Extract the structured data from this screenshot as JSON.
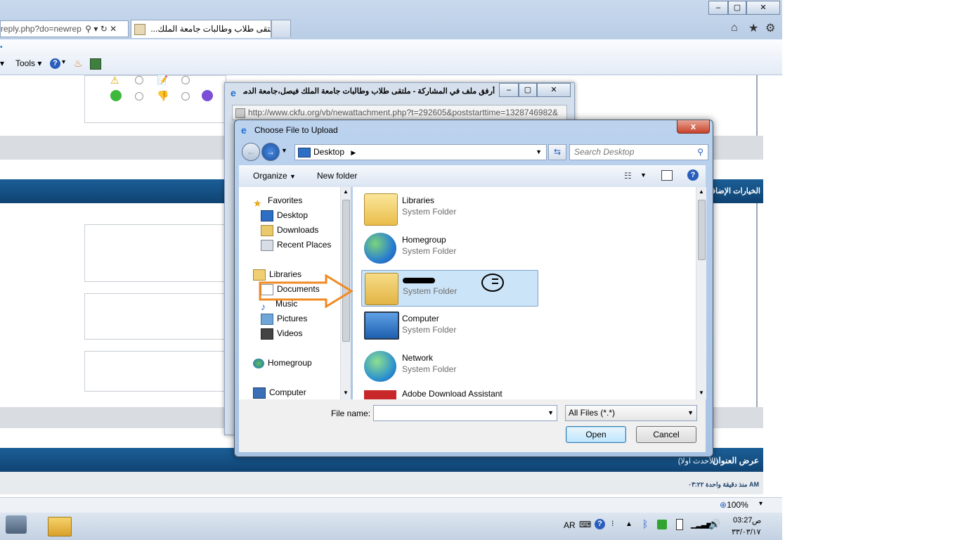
{
  "browser": {
    "address_text": "reply.php?do=newrep",
    "tab_title": "...ملتقى طلاب وطالبات جامعة الملك",
    "tab_close": "×",
    "command_tools": "Tools",
    "zoom": "100%"
  },
  "page": {
    "options_header": "الخيارات الإضافية",
    "view_title_label": "عرض العنوان",
    "view_title_note": "(الأحدث اولا)",
    "time_text": "منذ دقيقة واحدة ٠٣:٢٢ AM"
  },
  "popup": {
    "title": "أرفق ملف في المشاركة - ملتقى طلاب وطالبات جامعة الملك فيصل،جامعة الدمام - Win...",
    "url": "http://www.ckfu.org/vb/newattachment.php?t=292605&poststarttime=1328746982&"
  },
  "dialog": {
    "title": "Choose File to Upload",
    "close_label": "x",
    "breadcrumb": "Desktop",
    "search_placeholder": "Search Desktop",
    "toolbar": {
      "organize": "Organize",
      "new_folder": "New folder"
    },
    "nav": {
      "favorites": "Favorites",
      "desktop": "Desktop",
      "downloads": "Downloads",
      "recent": "Recent Places",
      "libraries": "Libraries",
      "documents": "Documents",
      "music": "Music",
      "pictures": "Pictures",
      "videos": "Videos",
      "homegroup": "Homegroup",
      "computer": "Computer"
    },
    "items": [
      {
        "name": "Libraries",
        "type": "System Folder"
      },
      {
        "name": "Homegroup",
        "type": "System Folder"
      },
      {
        "name": "",
        "type": "System Folder"
      },
      {
        "name": "Computer",
        "type": "System Folder"
      },
      {
        "name": "Network",
        "type": "System Folder"
      },
      {
        "name": "Adobe Download Assistant",
        "type": ""
      }
    ],
    "file_name_label": "File name:",
    "file_name_value": "",
    "filter": "All Files (*.*)",
    "open": "Open",
    "cancel": "Cancel"
  },
  "taskbar": {
    "lang": "AR",
    "time": "03:27",
    "ampm": "ص",
    "date": "٣٣/٠٣/١٧"
  },
  "colors": {
    "accent": "#1b5e97",
    "selection": "#cce4f7",
    "arrow": "#f08a24",
    "close_red": "#c7432b"
  }
}
